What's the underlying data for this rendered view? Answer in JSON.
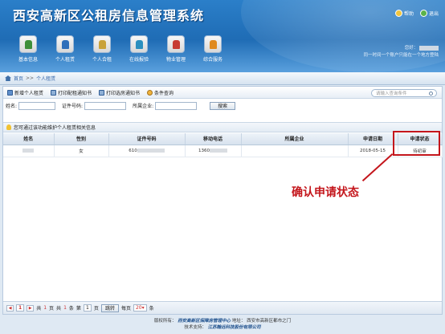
{
  "header": {
    "title": "西安高新区公租房信息管理系统",
    "links": [
      {
        "label": "帮助",
        "icon": "help-icon"
      },
      {
        "label": "退出",
        "icon": "exit-icon"
      }
    ],
    "nav": [
      {
        "label": "基本信息",
        "icon": "basic-info-icon"
      },
      {
        "label": "个人租赁",
        "icon": "personal-rent-icon"
      },
      {
        "label": "个人合租",
        "icon": "shared-rent-icon"
      },
      {
        "label": "在线报验",
        "icon": "online-report-icon"
      },
      {
        "label": "物业管理",
        "icon": "property-icon"
      },
      {
        "label": "综合服务",
        "icon": "service-icon"
      }
    ],
    "user": {
      "greeting": "您好：",
      "notice": "同一时间一个账户只能在一个地方登陆"
    }
  },
  "breadcrumb": {
    "home": "首页",
    "separator": ">>",
    "current": "个人租赁"
  },
  "toolbar": {
    "buttons": [
      "新增个人租赁",
      "打印配租通知书",
      "打印选房通知书",
      "条件查询"
    ],
    "search_placeholder": "请输入查询条件"
  },
  "filter": {
    "name_label": "姓名:",
    "id_label": "证件号码:",
    "company_label": "所属企业:",
    "search_button": "搜索"
  },
  "hint": "您可通过该功能维护个人租赁相关信息",
  "table": {
    "columns": [
      "姓名",
      "性别",
      "证件号码",
      "移动电话",
      "所属企业",
      "申请日期",
      "申请状态"
    ],
    "rows": [
      {
        "gender": "女",
        "id_prefix": "610",
        "phone_prefix": "1360",
        "date": "2018-05-15",
        "status": "待初审"
      }
    ]
  },
  "pager": {
    "page_prefix": "共",
    "total_pages": "1",
    "page_suffix": "页",
    "total_prefix": "共",
    "total_count": "1",
    "total_suffix": "条",
    "goto_prefix": "第",
    "goto_value": "1",
    "goto_suffix": "页",
    "jump_label": "跳转",
    "per_page_label": "每页",
    "per_page_value": "20",
    "per_page_suffix": "条",
    "current_page": "1"
  },
  "footer": {
    "owner_label": "版权所有：",
    "owner": "西安高新区保障房管理中心",
    "address_label": "地址：",
    "address": "西安市高新区都市之门",
    "support_label": "技术支持：",
    "support": "江苏翰远科技股份有限公司"
  },
  "annotation": {
    "text": "确认申请状态",
    "color": "#c4161c"
  }
}
